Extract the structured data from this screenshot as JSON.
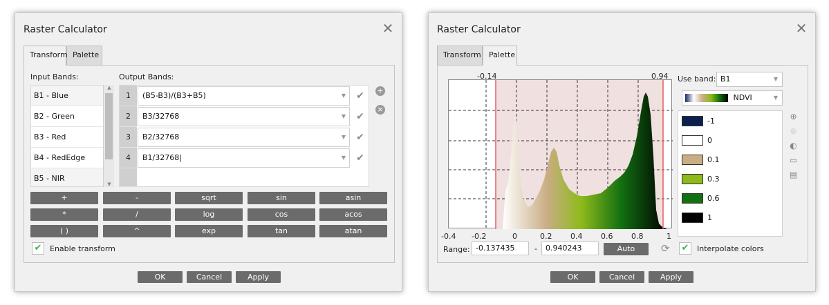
{
  "left": {
    "title": "Raster Calculator",
    "tabs": [
      "Transform",
      "Palette"
    ],
    "input_bands_label": "Input Bands:",
    "output_bands_label": "Output Bands:",
    "input_bands": [
      "B1 - Blue",
      "B2 - Green",
      "B3 - Red",
      "B4 - RedEdge",
      "B5 - NIR"
    ],
    "output_bands": [
      {
        "num": "1",
        "expr": "(B5-B3)/(B3+B5)"
      },
      {
        "num": "2",
        "expr": "B3/32768"
      },
      {
        "num": "3",
        "expr": "B2/32768"
      },
      {
        "num": "4",
        "expr": "B1/32768"
      }
    ],
    "operators": [
      [
        "+",
        "-",
        "sqrt",
        "sin",
        "asin"
      ],
      [
        "*",
        "/",
        "log",
        "cos",
        "acos"
      ],
      [
        "( )",
        "^",
        "exp",
        "tan",
        "atan"
      ]
    ],
    "enable_transform_label": "Enable transform",
    "buttons": {
      "ok": "OK",
      "cancel": "Cancel",
      "apply": "Apply"
    }
  },
  "right": {
    "title": "Raster Calculator",
    "tabs": [
      "Transform",
      "Palette"
    ],
    "use_band_label": "Use band:",
    "use_band_value": "B1",
    "palette_name": "NDVI",
    "marker_left": "-0.14",
    "marker_right": "0.94",
    "x_ticks": [
      "-0.4",
      "-0.2",
      "0",
      "0.2",
      "0.4",
      "0.6",
      "0.8",
      "1"
    ],
    "palette_entries": [
      {
        "label": "-1",
        "color": "#0d1f4f"
      },
      {
        "label": "0",
        "color": "#ffffff"
      },
      {
        "label": "0.1",
        "color": "#c9ad84"
      },
      {
        "label": "0.3",
        "color": "#8dba1a"
      },
      {
        "label": "0.6",
        "color": "#127012"
      },
      {
        "label": "1",
        "color": "#000000"
      }
    ],
    "range_label": "Range:",
    "range_min": "-0.137435",
    "range_sep": "-",
    "range_max": "0.940243",
    "auto_label": "Auto",
    "interpolate_label": "Interpolate colors",
    "buttons": {
      "ok": "OK",
      "cancel": "Cancel",
      "apply": "Apply"
    }
  }
}
